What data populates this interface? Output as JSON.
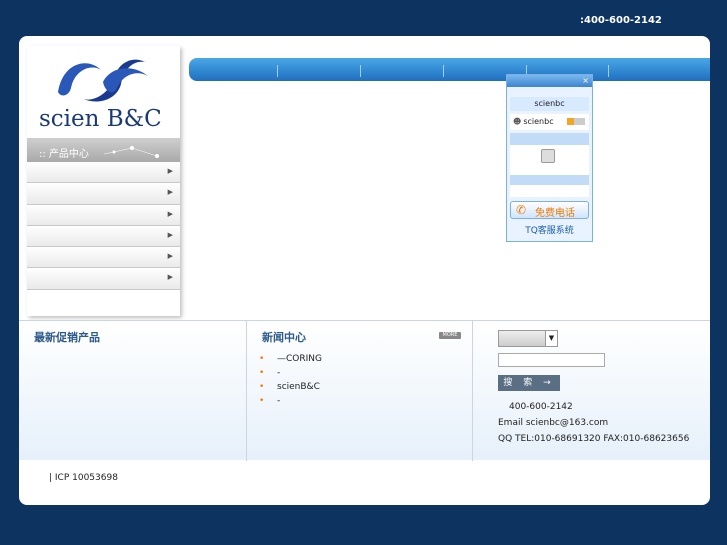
{
  "header": {
    "phone": ":400-600-2142"
  },
  "logo": {
    "text": "scien B&C"
  },
  "sidebar": {
    "category_title": ":: 产品中心",
    "items": [
      {
        "label": ""
      },
      {
        "label": ""
      },
      {
        "label": ""
      },
      {
        "label": ""
      },
      {
        "label": ""
      },
      {
        "label": ""
      }
    ]
  },
  "tq": {
    "close": "×",
    "name": "scienbc",
    "contact": "scienbc",
    "call_label": "免费电话",
    "footer": "TQ客服系统"
  },
  "promo": {
    "title": "最新促销产品"
  },
  "news": {
    "title": "新闻中心",
    "more": "MORE",
    "items": [
      "—CORING",
      "-",
      "scienB&C",
      "-"
    ]
  },
  "search": {
    "button": "搜 索 →",
    "phone": "400-600-2142",
    "email": "Email scienbc@163.com",
    "qq": "QQ TEL:010-68691320 FAX:010-68623656"
  },
  "footer": {
    "icp": "| ICP 10053698"
  },
  "colors": {
    "background": "#0d3360",
    "accent": "#1f6fc0",
    "call": "#f07b00"
  }
}
